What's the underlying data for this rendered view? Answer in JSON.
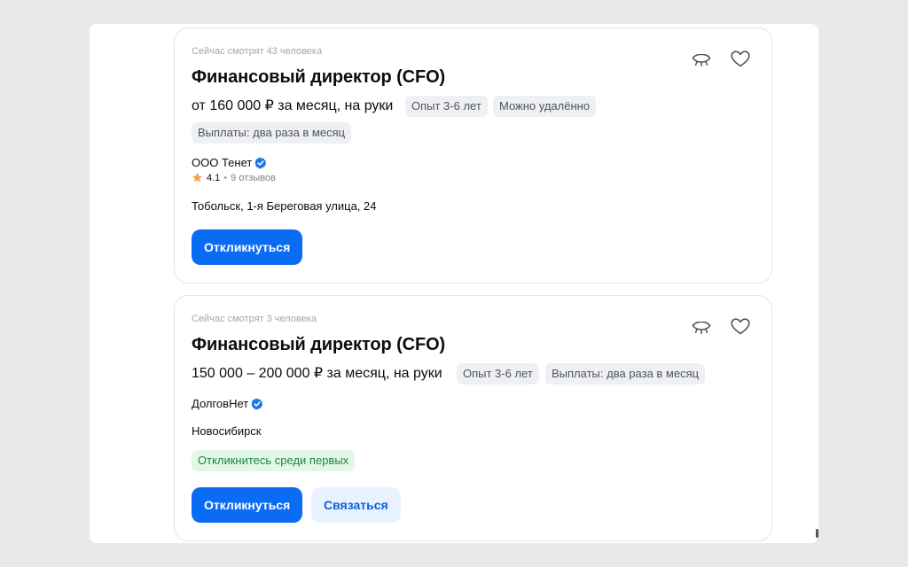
{
  "vacancies": [
    {
      "viewers": "Сейчас смотрят 43 человека",
      "title": "Финансовый директор (CFO)",
      "salary": "от 160 000 ₽ за месяц, на руки",
      "chips": [
        "Опыт 3-6 лет",
        "Можно удалённо",
        "Выплаты: два раза в месяц"
      ],
      "company": "ООО Тенет",
      "rating": "4.1",
      "rating_sep": "•",
      "reviews": "9 отзывов",
      "location": "Тобольск, 1-я Береговая улица, 24",
      "respond_label": "Откликнуться"
    },
    {
      "viewers": "Сейчас смотрят 3 человека",
      "title": "Финансовый директор (CFO)",
      "salary": "150 000 – 200 000 ₽ за месяц, на руки",
      "chips": [
        "Опыт 3-6 лет",
        "Выплаты: два раза в месяц"
      ],
      "company": "ДолговНет",
      "location": "Новосибирск",
      "badge": "Откликнитесь среди первых",
      "respond_label": "Откликнуться",
      "contact_label": "Связаться"
    }
  ],
  "colors": {
    "primary": "#0a6cf5",
    "verified": "#1a73e8",
    "star": "#f5a24b",
    "green_badge_text": "#17893a"
  },
  "icons": [
    "hide-eye-icon",
    "heart-icon",
    "verified-icon",
    "star-icon"
  ]
}
